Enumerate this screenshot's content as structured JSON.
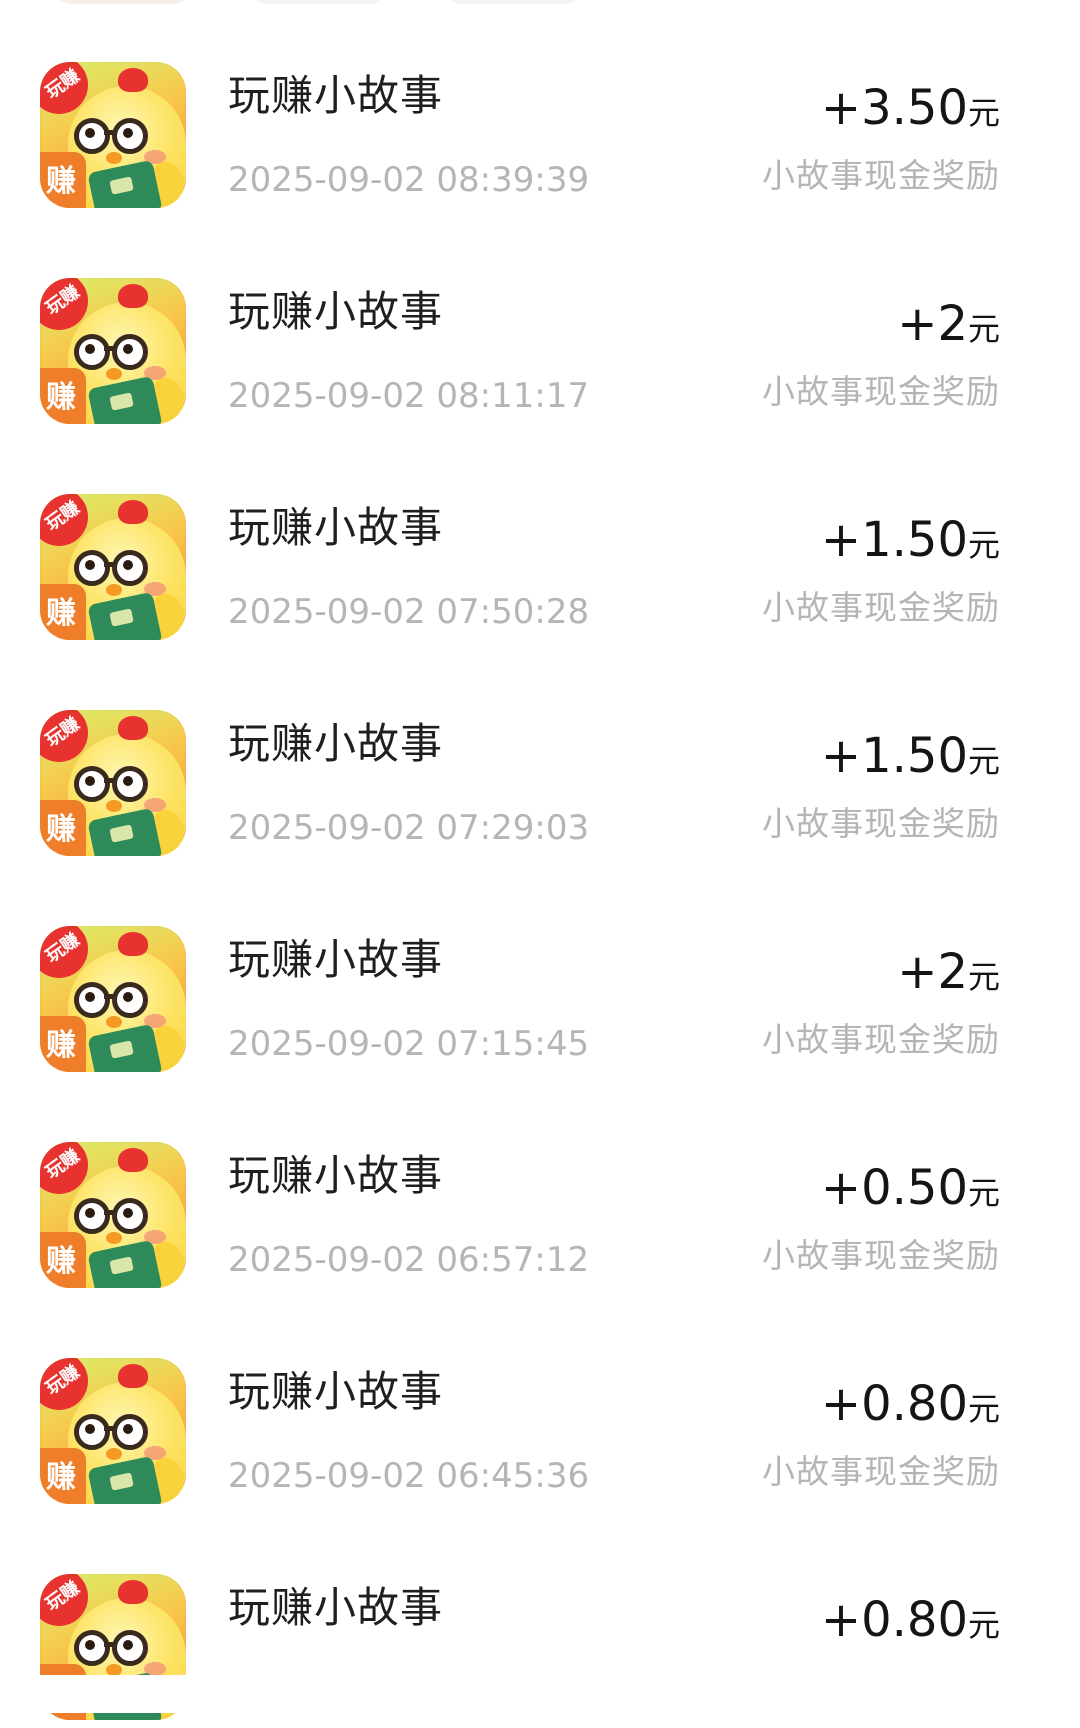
{
  "records": [
    {
      "title": "玩赚小故事",
      "time": "2025-09-02 08:39:39",
      "amount": "+3.50",
      "unit": "元",
      "desc": "小故事现金奖励"
    },
    {
      "title": "玩赚小故事",
      "time": "2025-09-02 08:11:17",
      "amount": "+2",
      "unit": "元",
      "desc": "小故事现金奖励"
    },
    {
      "title": "玩赚小故事",
      "time": "2025-09-02 07:50:28",
      "amount": "+1.50",
      "unit": "元",
      "desc": "小故事现金奖励"
    },
    {
      "title": "玩赚小故事",
      "time": "2025-09-02 07:29:03",
      "amount": "+1.50",
      "unit": "元",
      "desc": "小故事现金奖励"
    },
    {
      "title": "玩赚小故事",
      "time": "2025-09-02 07:15:45",
      "amount": "+2",
      "unit": "元",
      "desc": "小故事现金奖励"
    },
    {
      "title": "玩赚小故事",
      "time": "2025-09-02 06:57:12",
      "amount": "+0.50",
      "unit": "元",
      "desc": "小故事现金奖励"
    },
    {
      "title": "玩赚小故事",
      "time": "2025-09-02 06:45:36",
      "amount": "+0.80",
      "unit": "元",
      "desc": "小故事现金奖励"
    },
    {
      "title": "玩赚小故事",
      "amount": "+0.80",
      "unit": "元"
    }
  ],
  "app_icon": {
    "icon": "chick-reading-book-icon",
    "badge_top": "玩赚",
    "badge_bottom": "赚"
  }
}
